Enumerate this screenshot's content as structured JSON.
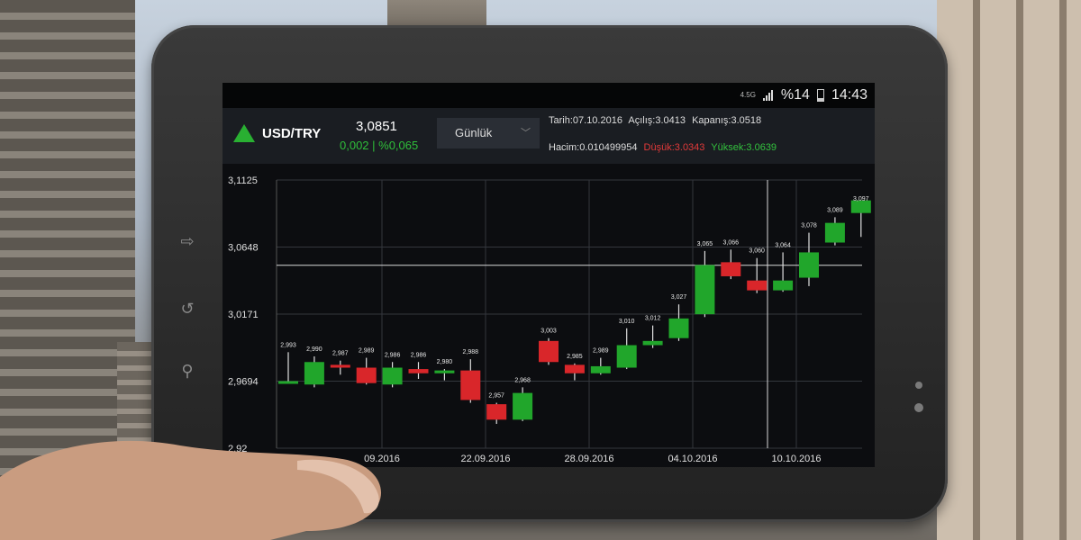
{
  "status_bar": {
    "network": "4.5G",
    "battery": "%14",
    "time": "14:43"
  },
  "header": {
    "pair": "USD/TRY",
    "price": "3,0851",
    "change": "0,002 | %0,065",
    "period": "Günlük",
    "date": "Tarih:07.10.2016",
    "open": "Açılış:3.0413",
    "close": "Kapanış:3.0518",
    "volume": "Hacim:0.010499954",
    "low": "Düşük:3.0343",
    "high": "Yüksek:3.0639"
  },
  "colors": {
    "up": "#21a62b",
    "down": "#d9262a",
    "accent_green": "#29b032"
  },
  "icons": [
    "up-triangle-icon",
    "chevron-down-icon",
    "signal-icon",
    "battery-icon",
    "back-icon",
    "home-icon",
    "search-icon"
  ],
  "chart_data": {
    "type": "candlestick",
    "y_ticks": [
      "3,1125",
      "3,0648",
      "3,0171",
      "2,9694",
      "2,92"
    ],
    "x_ticks": [
      "09.2016",
      "22.09.2016",
      "28.09.2016",
      "04.10.2016",
      "10.10.2016"
    ],
    "ylim": [
      2.9217,
      3.1125
    ],
    "grid": true,
    "candles": [
      {
        "label": "2,993",
        "open": 2.9694,
        "close": 2.9694,
        "high": 2.99,
        "low": 2.968
      },
      {
        "label": "2,990",
        "open": 2.967,
        "close": 2.983,
        "high": 2.987,
        "low": 2.965
      },
      {
        "label": "2,987",
        "open": 2.981,
        "close": 2.979,
        "high": 2.984,
        "low": 2.974
      },
      {
        "label": "2,989",
        "open": 2.979,
        "close": 2.968,
        "high": 2.986,
        "low": 2.967
      },
      {
        "label": "2,986",
        "open": 2.967,
        "close": 2.979,
        "high": 2.983,
        "low": 2.965
      },
      {
        "label": "2,986",
        "open": 2.978,
        "close": 2.975,
        "high": 2.983,
        "low": 2.971
      },
      {
        "label": "2,980",
        "open": 2.975,
        "close": 2.977,
        "high": 2.978,
        "low": 2.97
      },
      {
        "label": "2,988",
        "open": 2.977,
        "close": 2.956,
        "high": 2.985,
        "low": 2.954
      },
      {
        "label": "2,957",
        "open": 2.953,
        "close": 2.942,
        "high": 2.954,
        "low": 2.939
      },
      {
        "label": "2,968",
        "open": 2.942,
        "close": 2.961,
        "high": 2.965,
        "low": 2.941
      },
      {
        "label": "3,003",
        "open": 2.998,
        "close": 2.983,
        "high": 3.0,
        "low": 2.981
      },
      {
        "label": "2,985",
        "open": 2.981,
        "close": 2.975,
        "high": 2.982,
        "low": 2.97
      },
      {
        "label": "2,989",
        "open": 2.975,
        "close": 2.98,
        "high": 2.986,
        "low": 2.974
      },
      {
        "label": "3,010",
        "open": 2.979,
        "close": 2.995,
        "high": 3.007,
        "low": 2.978
      },
      {
        "label": "3,012",
        "open": 2.995,
        "close": 2.998,
        "high": 3.009,
        "low": 2.993
      },
      {
        "label": "3,027",
        "open": 3.0,
        "close": 3.014,
        "high": 3.024,
        "low": 2.998
      },
      {
        "label": "3,065",
        "open": 3.017,
        "close": 3.052,
        "high": 3.062,
        "low": 3.015
      },
      {
        "label": "3,066",
        "open": 3.054,
        "close": 3.044,
        "high": 3.063,
        "low": 3.042
      },
      {
        "label": "3,060",
        "open": 3.041,
        "close": 3.034,
        "high": 3.057,
        "low": 3.032
      },
      {
        "label": "3,064",
        "open": 3.034,
        "close": 3.041,
        "high": 3.061,
        "low": 3.033
      },
      {
        "label": "3,078",
        "open": 3.043,
        "close": 3.061,
        "high": 3.075,
        "low": 3.037
      },
      {
        "label": "3,089",
        "open": 3.068,
        "close": 3.082,
        "high": 3.086,
        "low": 3.066
      },
      {
        "label": "3,097",
        "open": 3.089,
        "close": 3.098,
        "high": 3.094,
        "low": 3.072
      }
    ]
  }
}
